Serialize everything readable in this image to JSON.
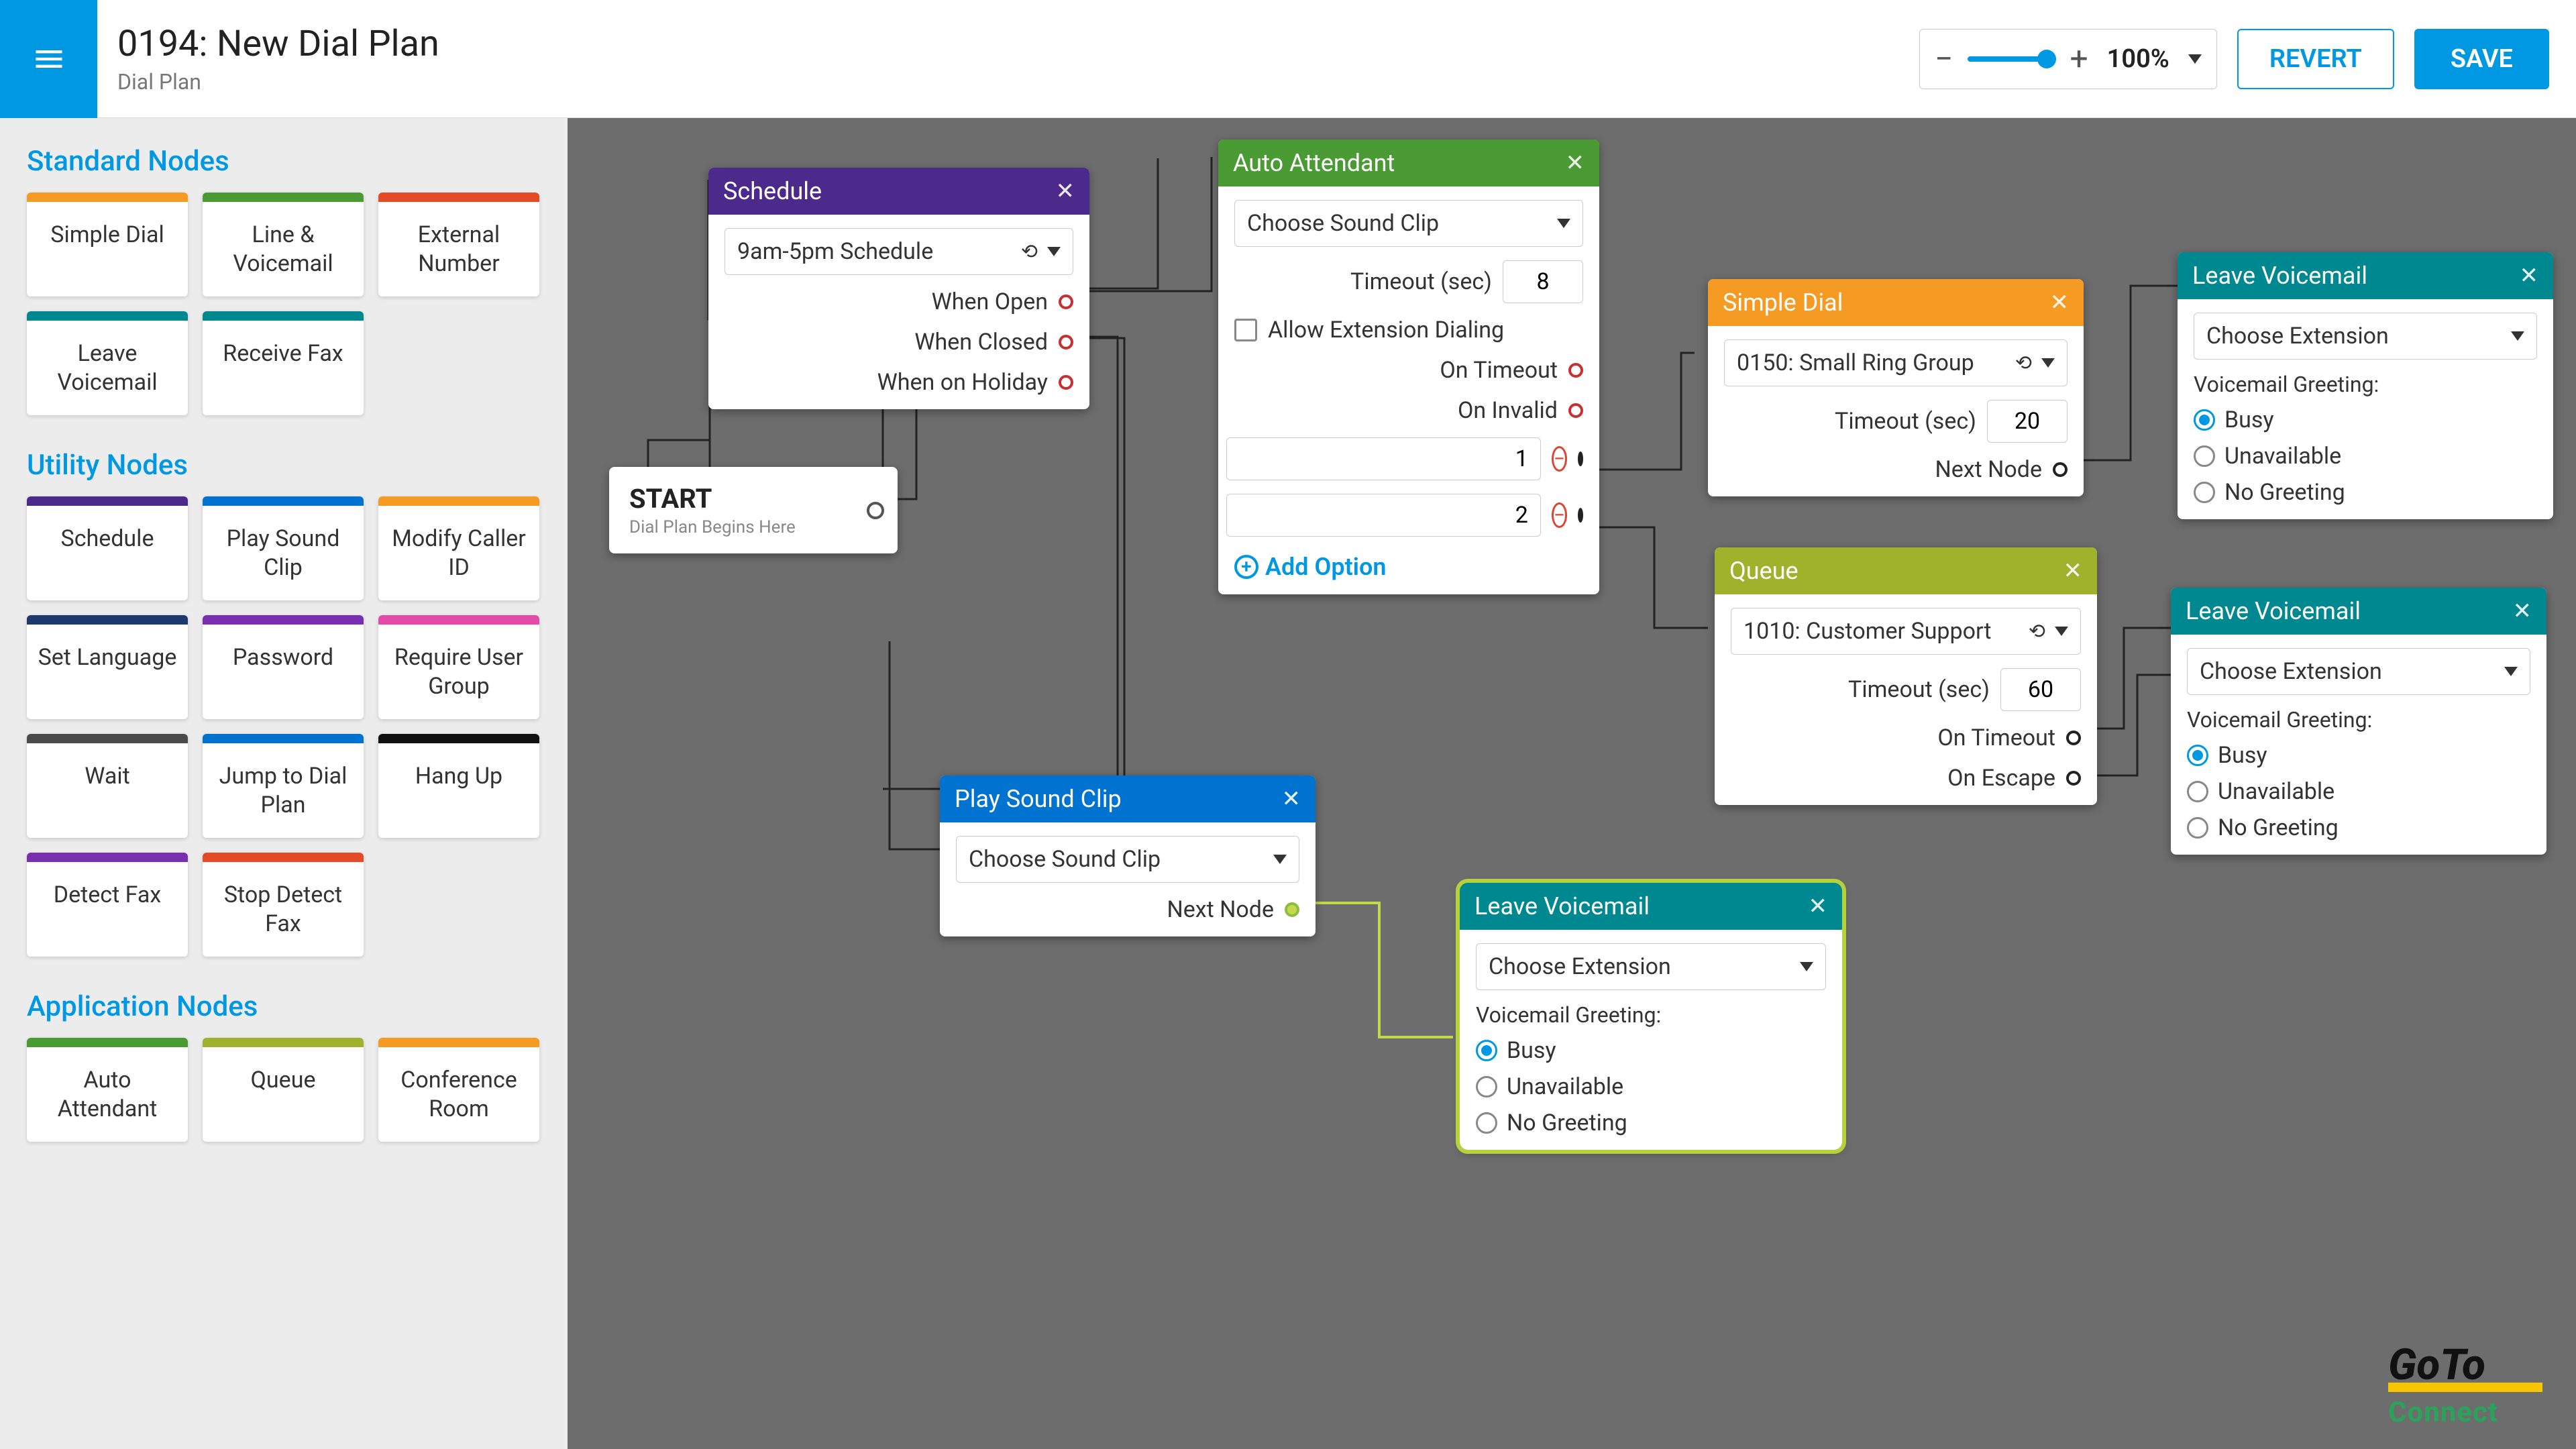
{
  "header": {
    "title": "0194: New Dial Plan",
    "subtitle": "Dial Plan",
    "zoom_label": "100%",
    "revert": "REVERT",
    "save": "SAVE"
  },
  "sidebar": {
    "sections": {
      "standard": "Standard Nodes",
      "utility": "Utility Nodes",
      "application": "Application Nodes"
    },
    "standard": [
      {
        "label": "Simple Dial",
        "color": "c-orange"
      },
      {
        "label": "Line & Voicemail",
        "color": "c-green"
      },
      {
        "label": "External Number",
        "color": "c-red"
      },
      {
        "label": "Leave Voicemail",
        "color": "c-teal"
      },
      {
        "label": "Receive Fax",
        "color": "c-teal"
      }
    ],
    "utility": [
      {
        "label": "Schedule",
        "color": "c-purple"
      },
      {
        "label": "Play Sound Clip",
        "color": "c-blue"
      },
      {
        "label": "Modify Caller ID",
        "color": "c-orange"
      },
      {
        "label": "Set Language",
        "color": "c-darkblue"
      },
      {
        "label": "Password",
        "color": "c-violet"
      },
      {
        "label": "Require User Group",
        "color": "c-pink"
      },
      {
        "label": "Wait",
        "color": "c-grey"
      },
      {
        "label": "Jump to Dial Plan",
        "color": "c-blue"
      },
      {
        "label": "Hang Up",
        "color": "c-black"
      },
      {
        "label": "Detect Fax",
        "color": "c-violet"
      },
      {
        "label": "Stop Detect Fax",
        "color": "c-red"
      }
    ],
    "application": [
      {
        "label": "Auto Attendant",
        "color": "c-green"
      },
      {
        "label": "Queue",
        "color": "c-olive"
      },
      {
        "label": "Conference Room",
        "color": "c-orange"
      }
    ]
  },
  "start": {
    "title": "START",
    "subtitle": "Dial Plan Begins Here"
  },
  "schedule": {
    "title": "Schedule",
    "select": "9am-5pm Schedule",
    "when_open": "When Open",
    "when_closed": "When Closed",
    "when_holiday": "When on Holiday"
  },
  "auto_attendant": {
    "title": "Auto Attendant",
    "sound_clip": "Choose Sound Clip",
    "timeout_label": "Timeout (sec)",
    "timeout_value": "8",
    "allow_ext": "Allow Extension Dialing",
    "on_timeout": "On Timeout",
    "on_invalid": "On Invalid",
    "opt1": "1",
    "opt2": "2",
    "add_option": "Add Option"
  },
  "simple_dial": {
    "title": "Simple Dial",
    "target": "0150: Small Ring Group",
    "timeout_label": "Timeout (sec)",
    "timeout_value": "20",
    "next_node": "Next Node"
  },
  "queue": {
    "title": "Queue",
    "target": "1010: Customer Support",
    "timeout_label": "Timeout (sec)",
    "timeout_value": "60",
    "on_timeout": "On Timeout",
    "on_escape": "On Escape"
  },
  "play_sound": {
    "title": "Play Sound Clip",
    "sound_clip": "Choose Sound Clip",
    "next_node": "Next Node"
  },
  "voicemail": {
    "title": "Leave Voicemail",
    "choose_ext": "Choose Extension",
    "greeting_label": "Voicemail Greeting:",
    "busy": "Busy",
    "unavailable": "Unavailable",
    "no_greeting": "No Greeting"
  },
  "logo": {
    "goto": "GoTo",
    "connect": "Connect"
  }
}
